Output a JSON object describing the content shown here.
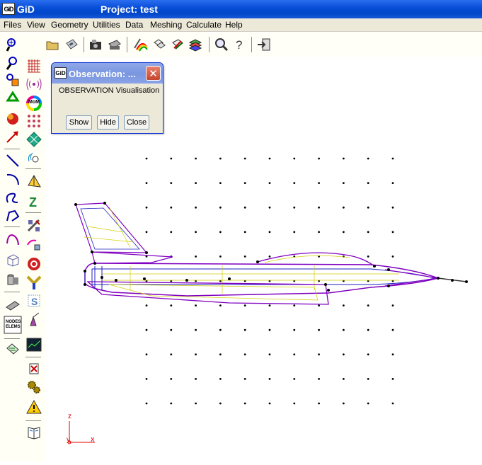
{
  "window": {
    "app_name": "GiD",
    "logo_text": "GiD",
    "project_title": "Project: test"
  },
  "menu": {
    "items": [
      "Files",
      "View",
      "Geometry",
      "Utilities",
      "Data",
      "Meshing",
      "Calculate",
      "Help"
    ]
  },
  "toolbar": {
    "icons": [
      "new-file-icon",
      "open-folder-icon",
      "save-icon",
      "import-icon",
      "print-icon",
      "render-icon",
      "layers-icon",
      "conditions-icon",
      "materials-icon",
      "zoom-icon",
      "help-icon",
      "exit-icon"
    ]
  },
  "observation_dialog": {
    "title": "Observation: ...",
    "text": "OBSERVATION Visualisation",
    "show_label": "Show",
    "hide_label": "Hide",
    "close_label": "Close"
  },
  "left_toolbar": {
    "icons": [
      "zoom-in-icon",
      "grid-icon",
      "zoom-out-icon",
      "antenna-icon",
      "zoom-frame-icon",
      "mom-icon",
      "redraw-icon",
      "dots-grid-icon",
      "rotate-icon",
      "diamond-grid-icon",
      "pan-icon",
      "wave-icon",
      "line-icon",
      "pyramid-icon",
      "arc-icon",
      "z-icon",
      "nurbs-line-icon",
      "satellite-icon",
      "polyline-icon",
      "sphere-icon",
      "surface-icon",
      "target-icon",
      "volume-icon",
      "y-icon",
      "cylinder-icon",
      "s-icon",
      "eraser-icon",
      "wand-icon",
      "nodes-elems-icon",
      "graph-icon",
      "list-icon",
      "delete-icon",
      "cogs-icon",
      "warning-icon",
      "book-icon"
    ],
    "nodes_elems_label": "NODES ELEMS",
    "mom_label": "MoM"
  },
  "axes": {
    "x_label": "x",
    "y_label": "y",
    "z_label": "z"
  },
  "colors": {
    "titlebar": "#0a4fd8",
    "menubar": "#ece9d8",
    "wire_purple": "#8000c0",
    "wire_yellow": "#e0e000",
    "wire_blue": "#2020c0",
    "axis_red": "#d00000"
  }
}
